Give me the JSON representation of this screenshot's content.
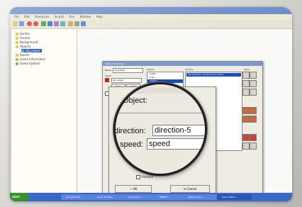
{
  "menubar": {
    "items": [
      "File",
      "Edit",
      "Resources",
      "Scripts",
      "Run",
      "Window",
      "Help"
    ]
  },
  "tree": {
    "items": [
      {
        "label": "Sprites",
        "icon": "folder-icon"
      },
      {
        "label": "Sounds",
        "icon": "folder-icon"
      },
      {
        "label": "Backgrounds",
        "icon": "folder-icon"
      },
      {
        "label": "Objects",
        "icon": "folder-icon"
      },
      {
        "label": "obj_player",
        "icon": "object-icon"
      },
      {
        "label": "Rooms",
        "icon": "folder-icon"
      },
      {
        "label": "Game Information",
        "icon": "info-icon"
      },
      {
        "label": "Game Options",
        "icon": "options-icon"
      }
    ]
  },
  "object_window": {
    "title": "Object Properties",
    "name_label": "Name:",
    "name_value": "obj_player",
    "sprite_label": "Sprite",
    "sprite_value": "spr_player",
    "new_button": "New",
    "edit_button": "Edit",
    "visible_label": "Visible",
    "events_label": "Events:",
    "events": [
      "<Left>",
      "<Up>",
      "<Right>"
    ],
    "actions_label": "Actions:",
    "action_item": "Set direction and speed of motion",
    "palette_label": "Move"
  },
  "zoom": {
    "object_label": "Object:",
    "direction_label": "direction:",
    "direction_value": "direction-5",
    "speed_label": "speed:",
    "speed_value": "speed"
  },
  "action_dialog": {
    "relative_label": "Relative",
    "ok_button": "OK",
    "cancel_button": "Cancel"
  },
  "taskbar": {
    "start_label": "start",
    "tasks": [
      "gmloadpoint/...",
      "Avant Browser",
      "Windows E...",
      "PMWiki",
      "gifs/moving/...",
      "Game Maker"
    ]
  }
}
